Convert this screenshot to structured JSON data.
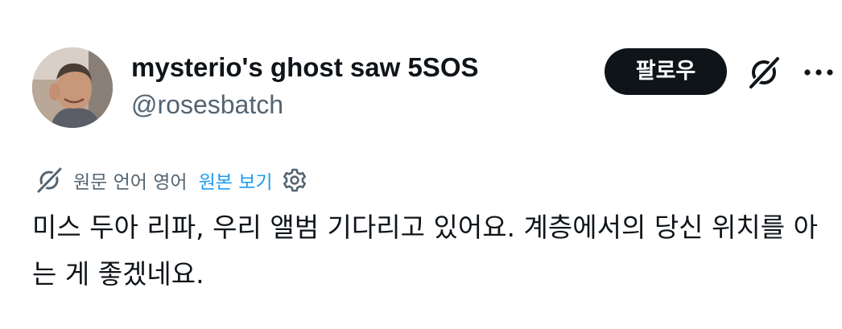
{
  "author": {
    "display_name": "mysterio's ghost saw 5SOS",
    "handle": "@rosesbatch"
  },
  "actions": {
    "follow_label": "팔로우",
    "grok_icon": "grok-icon",
    "more_icon": "more-icon"
  },
  "translation": {
    "icon": "translate-icon",
    "text": "원문 언어 영어",
    "show_original": "원본 보기",
    "settings_icon": "settings-icon"
  },
  "post": {
    "text": "미스 두아 리파, 우리 앨범 기다리고 있어요. 계층에서의 당신 위치를 아는 게 좋겠네요."
  },
  "colors": {
    "text": "#0f1419",
    "secondary": "#536471",
    "link": "#1d9bf0",
    "button_bg": "#0f1419",
    "button_text": "#ffffff"
  }
}
